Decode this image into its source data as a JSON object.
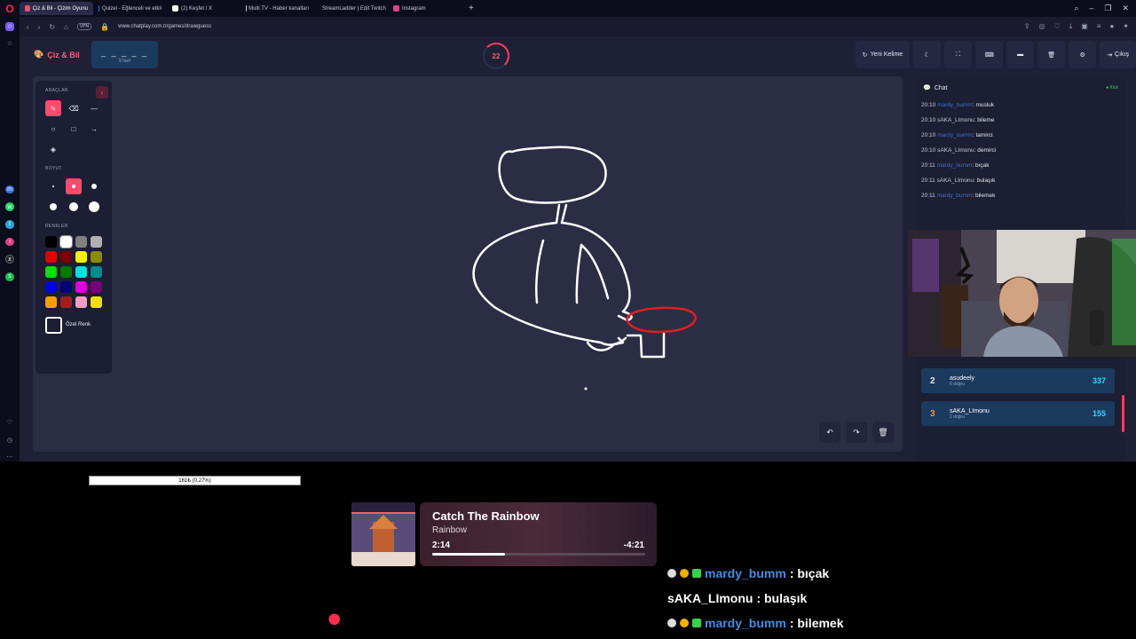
{
  "browser": {
    "tabs": [
      {
        "label": "Çiz & Bil - Çizim Oyunu",
        "color": "#ff4a6e",
        "active": true
      },
      {
        "label": "Quizei - Eğlenceli ve etkil",
        "color": "#3b6fd8",
        "active": false
      },
      {
        "label": "(2) Keşfet / X",
        "color": "#ffffff",
        "active": false
      },
      {
        "label": "Multi TV - Haber kanalları",
        "color": "#c8cad8",
        "active": false
      },
      {
        "label": "StreamLadder | Edit Twitch",
        "color": "#7a5cff",
        "active": false
      },
      {
        "label": "Instagram",
        "color": "#e0408a",
        "active": false
      }
    ],
    "url": "www.chatplay.com.tr/games/drawguess",
    "vpn": "VPN"
  },
  "game": {
    "brand": "Çiz & Bil",
    "word_dashes": "_ _ _ _ _",
    "word_hint": "5 harf",
    "timer": "22",
    "buttons": {
      "new_word": "Yeni Kelime",
      "exit": "Çıkış"
    },
    "tools": {
      "section_tools": "ARAÇLAR",
      "section_size": "BOYUT",
      "section_colors": "RENKLER",
      "custom_color": "Özel Renk",
      "swatches": [
        "#000000",
        "#ffffff",
        "#808080",
        "#b0b0b0",
        "#e00000",
        "#7a0000",
        "#f0f000",
        "#8a8a00",
        "#00e000",
        "#007a00",
        "#00e0e0",
        "#008a8a",
        "#0000e0",
        "#00007a",
        "#e000e0",
        "#7a007a",
        "#f0a000",
        "#a02020",
        "#f0a0c0",
        "#f0e000"
      ]
    }
  },
  "chat": {
    "title": "Chat",
    "status": "Kick",
    "messages": [
      {
        "time": "20:10",
        "user": "mardy_bumm",
        "text": "musluk",
        "kind": "u1"
      },
      {
        "time": "20:10",
        "user": "sAKA_LImonu",
        "text": "bileme",
        "kind": "u2"
      },
      {
        "time": "20:10",
        "user": "mardy_bumm",
        "text": "tamirci",
        "kind": "u1"
      },
      {
        "time": "20:10",
        "user": "sAKA_LImonu",
        "text": "demirci",
        "kind": "u2"
      },
      {
        "time": "20:11",
        "user": "mardy_bumm",
        "text": "bıçak",
        "kind": "u1"
      },
      {
        "time": "20:11",
        "user": "sAKA_LImonu",
        "text": "bulaşık",
        "kind": "u2"
      },
      {
        "time": "20:11",
        "user": "mardy_bumm",
        "text": "bilemek",
        "kind": "u1"
      }
    ]
  },
  "leaderboard": [
    {
      "rank": "2",
      "name": "asudeely",
      "sub": "6 doğru",
      "score": "337"
    },
    {
      "rank": "3",
      "name": "sAKA_LImonu",
      "sub": "2 doğru",
      "score": "155"
    }
  ],
  "overlay": {
    "progress_text": "161₺ (0.27%)",
    "song": "Catch The Rainbow",
    "artist": "Rainbow",
    "elapsed": "2:14",
    "remaining": "-4:21",
    "progress": 0.34,
    "chat": [
      {
        "user": "mardy_bumm",
        "msg": ": bıçak",
        "blue": true
      },
      {
        "user": "sAKA_LImonu",
        "msg": ": bulaşık",
        "blue": false
      },
      {
        "user": "mardy_bumm",
        "msg": ": bilemek",
        "blue": true
      }
    ]
  }
}
